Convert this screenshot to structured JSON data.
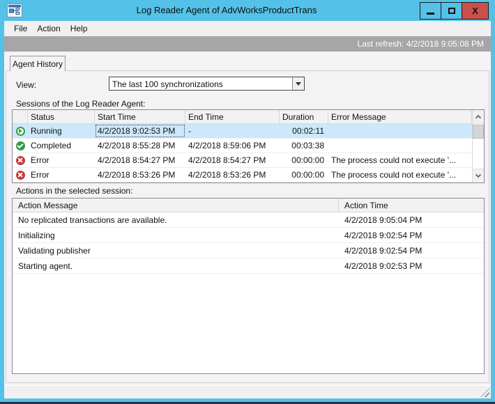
{
  "window": {
    "title": "Log Reader Agent of AdvWorksProductTrans"
  },
  "menu": {
    "items": [
      "File",
      "Action",
      "Help"
    ]
  },
  "refresh": {
    "text": "Last refresh: 4/2/2018 9:05:08 PM"
  },
  "tab": {
    "label": "Agent History"
  },
  "view": {
    "label": "View:",
    "value": "The last 100 synchronizations"
  },
  "sessions": {
    "label": "Sessions of the Log Reader Agent:",
    "columns": [
      "",
      "Status",
      "Start Time",
      "End Time",
      "Duration",
      "Error Message"
    ],
    "rows": [
      {
        "status": "Running",
        "start": "4/2/2018 9:02:53 PM",
        "end": "-",
        "duration": "00:02:11",
        "error": ""
      },
      {
        "status": "Completed",
        "start": "4/2/2018 8:55:28 PM",
        "end": "4/2/2018 8:59:06 PM",
        "duration": "00:03:38",
        "error": ""
      },
      {
        "status": "Error",
        "start": "4/2/2018 8:54:27 PM",
        "end": "4/2/2018 8:54:27 PM",
        "duration": "00:00:00",
        "error": "The process could not execute '..."
      },
      {
        "status": "Error",
        "start": "4/2/2018 8:53:26 PM",
        "end": "4/2/2018 8:53:26 PM",
        "duration": "00:00:00",
        "error": "The process could not execute '..."
      }
    ]
  },
  "actions": {
    "label": "Actions in the selected session:",
    "columns": [
      "Action Message",
      "Action Time"
    ],
    "rows": [
      {
        "message": "No replicated transactions are available.",
        "time": "4/2/2018 9:05:04 PM"
      },
      {
        "message": "Initializing",
        "time": "4/2/2018 9:02:54 PM"
      },
      {
        "message": "Validating publisher",
        "time": "4/2/2018 9:02:54 PM"
      },
      {
        "message": "Starting agent.",
        "time": "4/2/2018 9:02:53 PM"
      }
    ]
  },
  "colors": {
    "titlebar": "#54c1e8",
    "close_button": "#c9504c",
    "refresh_bar": "#a6a6a6",
    "selected_row": "#cbe8fc",
    "status_green": "#2f9e44",
    "status_red": "#c43c3c"
  }
}
